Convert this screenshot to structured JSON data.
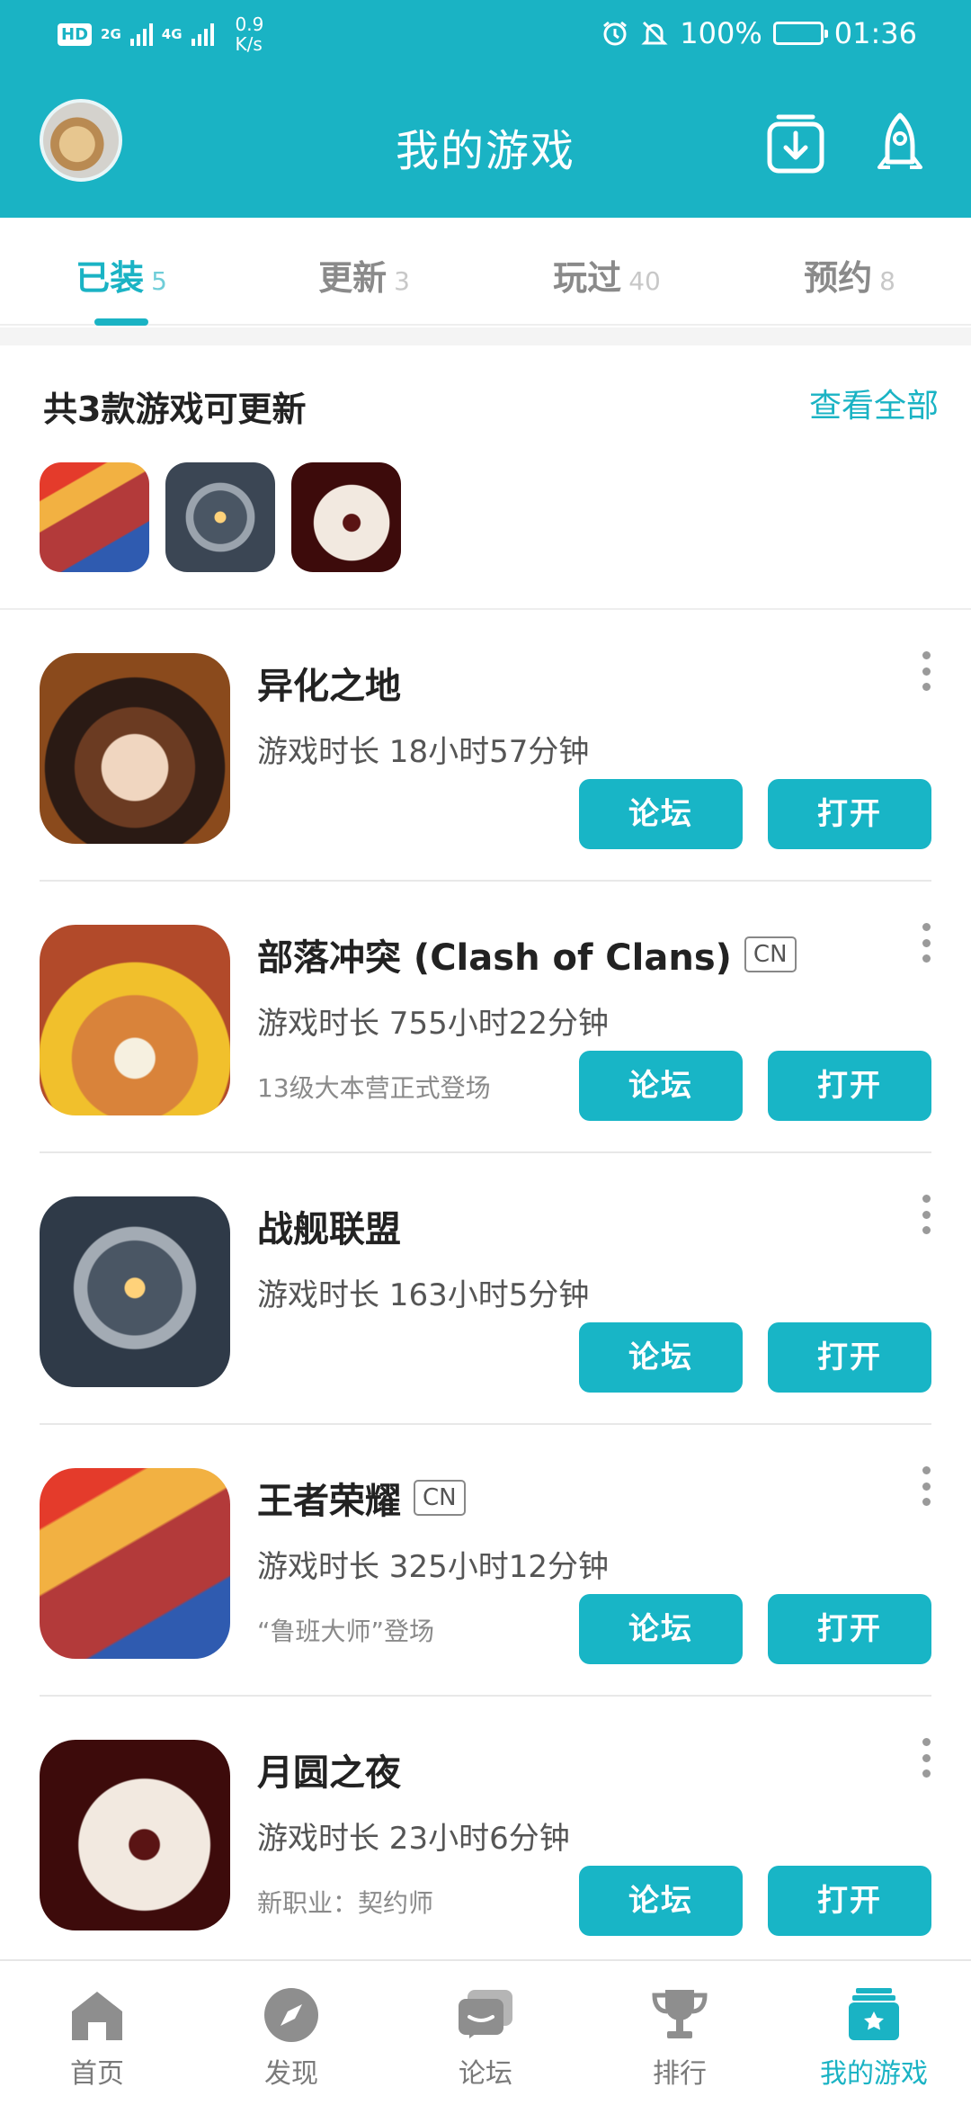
{
  "status_bar": {
    "hd": "HD",
    "sim1_net": "2G",
    "sim2_net": "4G",
    "net_speed_value": "0.9",
    "net_speed_unit": "K/s",
    "battery": "100%",
    "time": "01:36"
  },
  "header": {
    "title": "我的游戏",
    "accent_color": "#1ab3c4"
  },
  "tabs": [
    {
      "label": "已装",
      "count": "5",
      "active": true
    },
    {
      "label": "更新",
      "count": "3",
      "active": false
    },
    {
      "label": "玩过",
      "count": "40",
      "active": false
    },
    {
      "label": "预约",
      "count": "8",
      "active": false
    }
  ],
  "updates": {
    "title": "共3款游戏可更新",
    "view_all": "查看全部",
    "icons": [
      "honor-of-kings-icon",
      "warship-league-icon",
      "moon-night-icon"
    ]
  },
  "games": [
    {
      "name": "异化之地",
      "region": "",
      "time": "游戏时长 18小时57分钟",
      "note": "",
      "forum": "论坛",
      "open": "打开"
    },
    {
      "name": "部落冲突 (Clash of Clans)",
      "region": "CN",
      "time": "游戏时长 755小时22分钟",
      "note": "13级大本营正式登场",
      "forum": "论坛",
      "open": "打开"
    },
    {
      "name": "战舰联盟",
      "region": "",
      "time": "游戏时长 163小时5分钟",
      "note": "",
      "forum": "论坛",
      "open": "打开"
    },
    {
      "name": "王者荣耀",
      "region": "CN",
      "time": "游戏时长 325小时12分钟",
      "note": "“鲁班大师”登场",
      "forum": "论坛",
      "open": "打开"
    },
    {
      "name": "月圆之夜",
      "region": "",
      "time": "游戏时长 23小时6分钟",
      "note": "新职业：契约师",
      "forum": "论坛",
      "open": "打开"
    }
  ],
  "bottom_nav": [
    {
      "label": "首页",
      "icon": "home-icon",
      "active": false
    },
    {
      "label": "发现",
      "icon": "compass-icon",
      "active": false
    },
    {
      "label": "论坛",
      "icon": "chat-icon",
      "active": false
    },
    {
      "label": "排行",
      "icon": "trophy-icon",
      "active": false
    },
    {
      "label": "我的游戏",
      "icon": "my-games-icon",
      "active": true
    }
  ]
}
